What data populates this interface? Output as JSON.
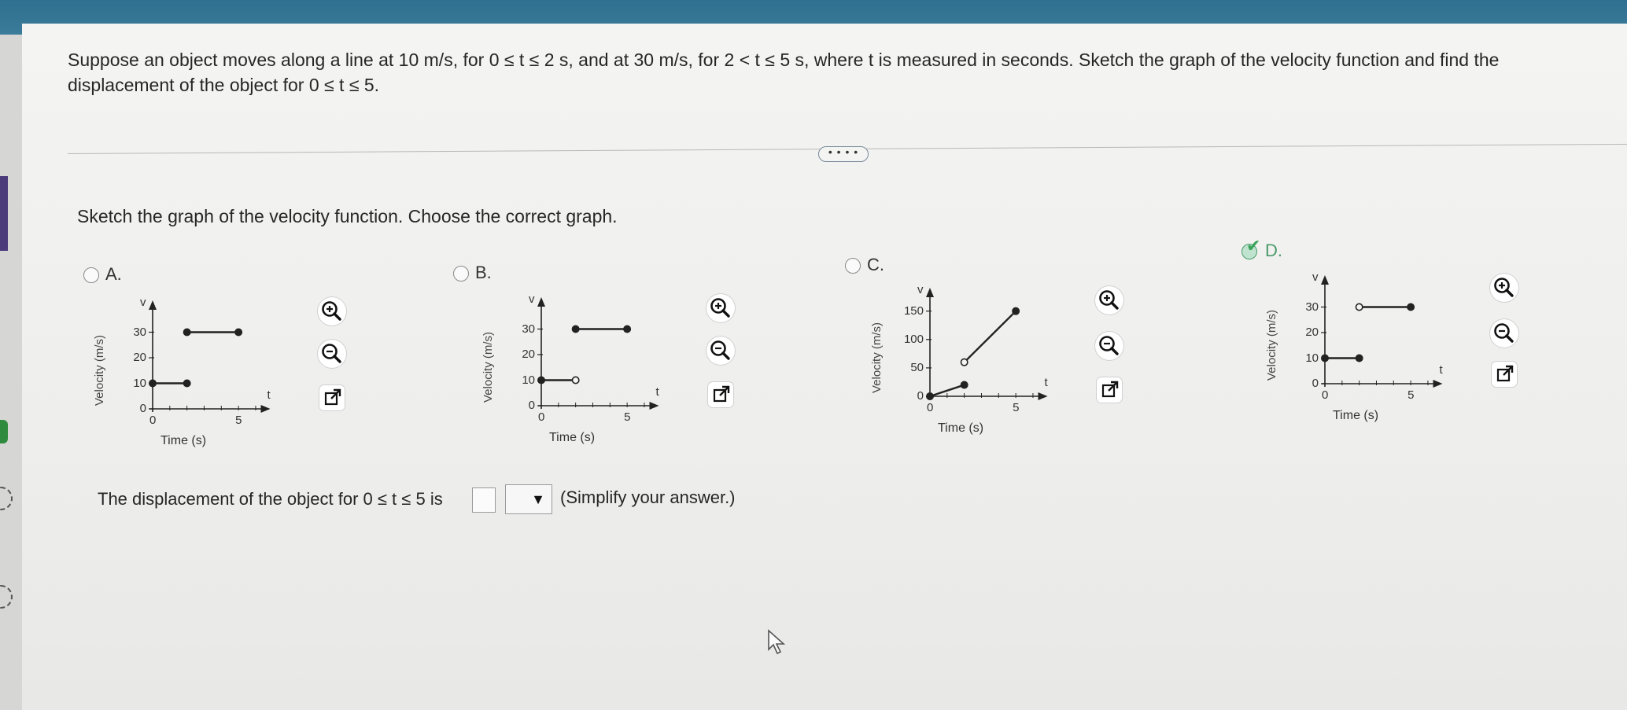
{
  "question": {
    "text": "Suppose an object moves along a line at 10 m/s, for 0 ≤ t ≤ 2 s, and at 30 m/s, for 2 < t ≤ 5 s, where t is measured in seconds. Sketch the graph of the velocity function and find the displacement of the object for 0 ≤ t ≤ 5."
  },
  "more_button_label": "• • • •",
  "prompt": "Sketch the graph of the velocity function. Choose the correct graph.",
  "options": [
    {
      "letter": "A.",
      "selected": false,
      "y_label": "Velocity (m/s)",
      "x_label": "Time (s)",
      "v_label": "v",
      "t_label": "t",
      "x_tick": "5",
      "origin": "0",
      "y_ticks": [
        "30",
        "20",
        "10",
        "0"
      ],
      "segments": [
        {
          "from": [
            0,
            10
          ],
          "to": [
            2,
            10
          ],
          "start": "closed",
          "end": "closed"
        },
        {
          "from": [
            2,
            30
          ],
          "to": [
            5,
            30
          ],
          "start": "closed",
          "end": "closed"
        }
      ]
    },
    {
      "letter": "B.",
      "selected": false,
      "y_label": "Velocity (m/s)",
      "x_label": "Time (s)",
      "v_label": "v",
      "t_label": "t",
      "x_tick": "5",
      "origin": "0",
      "y_ticks": [
        "30",
        "20",
        "10",
        "0"
      ],
      "segments": [
        {
          "from": [
            0,
            10
          ],
          "to": [
            2,
            10
          ],
          "start": "closed",
          "end": "open"
        },
        {
          "from": [
            2,
            30
          ],
          "to": [
            5,
            30
          ],
          "start": "closed",
          "end": "closed"
        }
      ]
    },
    {
      "letter": "C.",
      "selected": false,
      "y_label": "Velocity (m/s)",
      "x_label": "Time (s)",
      "v_label": "v",
      "t_label": "t",
      "x_tick": "5",
      "origin": "0",
      "y_ticks": [
        "150",
        "100",
        "50",
        "0"
      ],
      "segments": [
        {
          "from": [
            0,
            0
          ],
          "to": [
            2,
            20
          ],
          "start": "closed",
          "end": "closed"
        },
        {
          "from": [
            2,
            60
          ],
          "to": [
            5,
            150
          ],
          "start": "open",
          "end": "closed"
        }
      ]
    },
    {
      "letter": "D.",
      "selected": true,
      "y_label": "Velocity (m/s)",
      "x_label": "Time (s)",
      "v_label": "v",
      "t_label": "t",
      "x_tick": "5",
      "origin": "0",
      "y_ticks": [
        "30",
        "20",
        "10",
        "0"
      ],
      "segments": [
        {
          "from": [
            0,
            10
          ],
          "to": [
            2,
            10
          ],
          "start": "closed",
          "end": "closed"
        },
        {
          "from": [
            2,
            30
          ],
          "to": [
            5,
            30
          ],
          "start": "open",
          "end": "closed"
        }
      ]
    }
  ],
  "answer": {
    "text": "The displacement of the object for 0 ≤ t ≤ 5 is",
    "value": "",
    "unit": "",
    "hint": "(Simplify your answer.)"
  },
  "icons": {
    "zoom_in": "zoom-in-icon",
    "zoom_out": "zoom-out-icon",
    "popout": "popout-icon"
  },
  "colors": {
    "accent_check": "#3aa35a",
    "header": "#2f6f8f",
    "line": "#222222"
  }
}
